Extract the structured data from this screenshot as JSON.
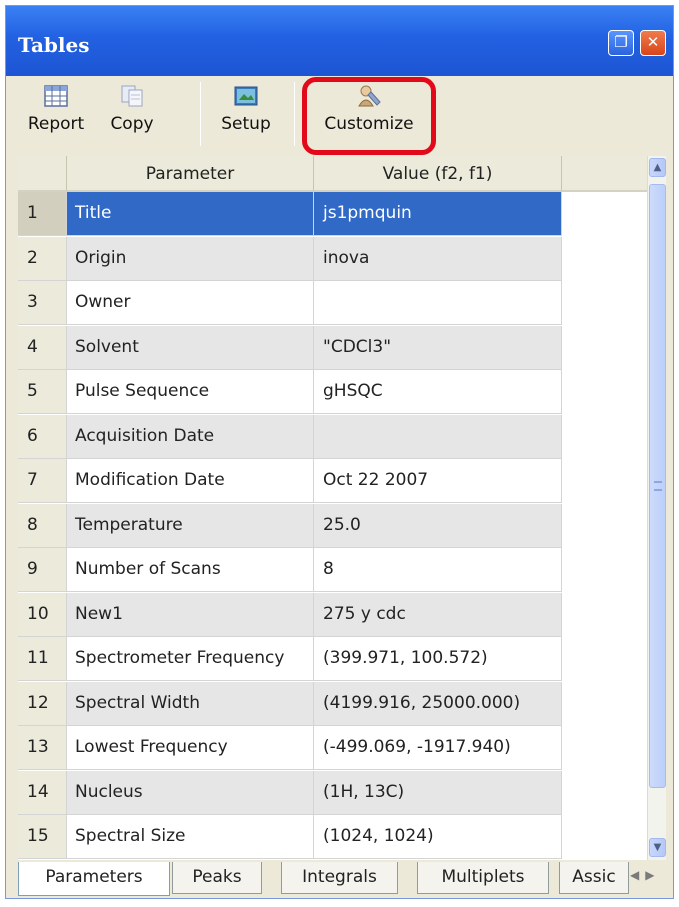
{
  "window": {
    "title": "Tables"
  },
  "toolbar": {
    "report": "Report",
    "copy": "Copy",
    "setup": "Setup",
    "customize": "Customize"
  },
  "grid": {
    "columns": [
      "Parameter",
      "Value (f2, f1)"
    ],
    "selected_row": 1,
    "rows": [
      {
        "num": "1",
        "parameter": "Title",
        "value": "js1pmquin"
      },
      {
        "num": "2",
        "parameter": "Origin",
        "value": "inova"
      },
      {
        "num": "3",
        "parameter": "Owner",
        "value": ""
      },
      {
        "num": "4",
        "parameter": "Solvent",
        "value": "\"CDCl3\""
      },
      {
        "num": "5",
        "parameter": "Pulse Sequence",
        "value": "gHSQC"
      },
      {
        "num": "6",
        "parameter": "Acquisition Date",
        "value": ""
      },
      {
        "num": "7",
        "parameter": "Modification Date",
        "value": "Oct 22 2007"
      },
      {
        "num": "8",
        "parameter": "Temperature",
        "value": "25.0"
      },
      {
        "num": "9",
        "parameter": "Number of Scans",
        "value": "8"
      },
      {
        "num": "10",
        "parameter": "New1",
        "value": "275 y cdc"
      },
      {
        "num": "11",
        "parameter": "Spectrometer Frequency",
        "value": "(399.971, 100.572)"
      },
      {
        "num": "12",
        "parameter": "Spectral Width",
        "value": "(4199.916, 25000.000)"
      },
      {
        "num": "13",
        "parameter": "Lowest Frequency",
        "value": "(-499.069, -1917.940)"
      },
      {
        "num": "14",
        "parameter": "Nucleus",
        "value": "(1H, 13C)"
      },
      {
        "num": "15",
        "parameter": "Spectral Size",
        "value": "(1024, 1024)"
      }
    ]
  },
  "tabs": [
    {
      "label": "Parameters",
      "active": true
    },
    {
      "label": "Peaks",
      "active": false
    },
    {
      "label": "Integrals",
      "active": false
    },
    {
      "label": "Multiplets",
      "active": false
    },
    {
      "label": "Assic",
      "active": false
    }
  ],
  "colors": {
    "title_bar": "#2261e2",
    "selection": "#3169c6",
    "highlight_box": "#e20a1a"
  },
  "icons": [
    "restore-icon",
    "close-icon",
    "report-table-icon",
    "copy-icon",
    "setup-icon",
    "customize-icon",
    "scroll-up-icon",
    "scroll-down-icon"
  ]
}
